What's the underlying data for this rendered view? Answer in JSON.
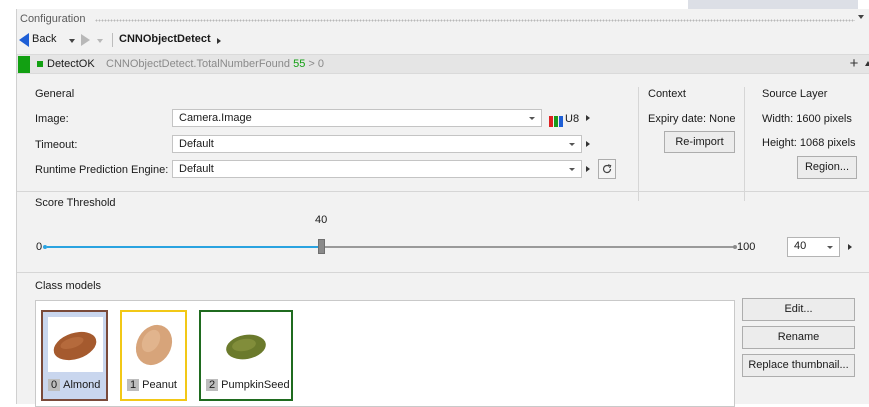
{
  "window": {
    "section_title": "Configuration"
  },
  "nav": {
    "back_label": "Back",
    "breadcrumb": "CNNObjectDetect"
  },
  "status": {
    "name": "DetectOK",
    "expression": "CNNObjectDetect.TotalNumberFound",
    "value": "55",
    "comparison": "> 0",
    "add_label": "+",
    "color": "#12a012"
  },
  "general": {
    "title": "General",
    "image_label": "Image:",
    "image_value": "Camera.Image",
    "image_format": "U8",
    "timeout_label": "Timeout:",
    "timeout_value": "Default",
    "engine_label": "Runtime Prediction Engine:",
    "engine_value": "Default",
    "refresh_icon": "refresh-icon"
  },
  "context": {
    "title": "Context",
    "expiry_label": "Expiry date: None",
    "reimport_label": "Re-import"
  },
  "source_layer": {
    "title": "Source Layer",
    "width_text": "Width: 1600 pixels",
    "height_text": "Height: 1068 pixels",
    "region_label": "Region..."
  },
  "score_threshold": {
    "title": "Score Threshold",
    "min": "0",
    "max": "100",
    "value": 40,
    "value_text": "40",
    "field_value": "40"
  },
  "class_models": {
    "title": "Class models",
    "items": [
      {
        "index": "0",
        "name": "Almond",
        "border": "#7a4a3a",
        "selected": true
      },
      {
        "index": "1",
        "name": "Peanut",
        "border": "#f2c816",
        "selected": false
      },
      {
        "index": "2",
        "name": "PumpkinSeed",
        "border": "#1f6b1f",
        "selected": false
      }
    ],
    "edit_label": "Edit...",
    "rename_label": "Rename",
    "replace_label": "Replace thumbnail..."
  },
  "colors": {
    "accent": "#2aa3e0",
    "back_arrow": "#1e5fd6"
  }
}
